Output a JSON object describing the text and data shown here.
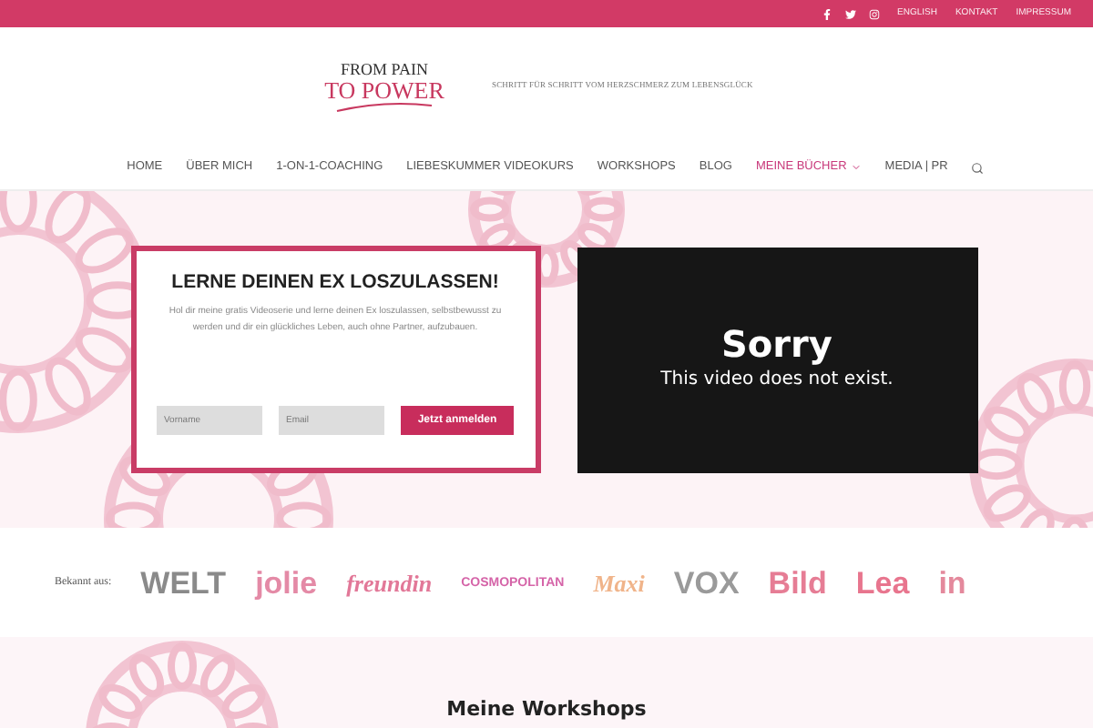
{
  "top_bar": {
    "social": [
      {
        "kind": "facebook"
      },
      {
        "kind": "twitter"
      },
      {
        "kind": "instagram"
      }
    ],
    "links": [
      "ENGLISH",
      "KONTAKT",
      "IMPRESSUM"
    ]
  },
  "header": {
    "logo": {
      "line_1": "FROM PAIN",
      "line_2": "TO POWER"
    },
    "tagline": "SCHRITT FÜR SCHRITT VOM HERZSCHMERZ ZUM LEBENSGLÜCK"
  },
  "nav": [
    {
      "label": "HOME",
      "selected": false,
      "dropdown": false
    },
    {
      "label": "ÜBER MICH",
      "selected": false,
      "dropdown": false
    },
    {
      "label": "1-ON-1-COACHING",
      "selected": false,
      "dropdown": false
    },
    {
      "label": "LIEBESKUMMER VIDEOKURS",
      "selected": false,
      "dropdown": false
    },
    {
      "label": "WORKSHOPS",
      "selected": false,
      "dropdown": false
    },
    {
      "label": "BLOG",
      "selected": false,
      "dropdown": false
    },
    {
      "label": "MEINE BÜCHER",
      "selected": true,
      "dropdown": true
    },
    {
      "label": "MEDIA | PR",
      "selected": false,
      "dropdown": false
    }
  ],
  "signup": {
    "title": "LERNE DEINEN EX LOSZULASSEN!",
    "text": "Hol dir meine gratis Videoserie und lerne deinen Ex loszulassen, selbstbewusst zu werden und dir ein glückliches Leben, auch ohne Partner, aufzubauen.",
    "fields": [
      {
        "placeholder": "Vorname"
      },
      {
        "placeholder": "Email"
      }
    ],
    "button": "Jetzt anmelden"
  },
  "video": {
    "title": "Sorry",
    "message": "This video does not exist."
  },
  "press": {
    "label": "Bekannt aus:",
    "logos": [
      {
        "text": "WELT",
        "color": "#8a8a8a"
      },
      {
        "text": "jolie",
        "color": "#e48aa6"
      },
      {
        "text": "freundin",
        "color": "#e27898"
      },
      {
        "text": "COSMOPOLITAN",
        "color": "#d564a8"
      },
      {
        "text": "Maxi",
        "color": "#f0b48a"
      },
      {
        "text": "VOX",
        "color": "#9a9a9a"
      },
      {
        "text": "Bild",
        "color": "#e67d95"
      },
      {
        "text": "Lea",
        "color": "#e8758e"
      },
      {
        "text": "in",
        "color": "#e4899c"
      }
    ]
  },
  "section_title": "Meine Workshops"
}
